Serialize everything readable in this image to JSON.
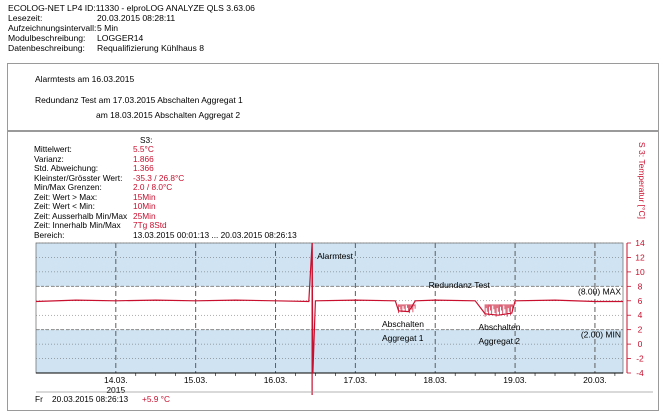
{
  "header": {
    "device_line": "ECOLOG-NET LP4  ID:11330    -  elproLOG ANALYZE QLS 3.63.06",
    "rows": [
      {
        "label": "Lesezeit:",
        "value": "20.03.2015  08:28:11"
      },
      {
        "label": "Aufzeichnungsintervall:",
        "value": "5 Min"
      },
      {
        "label": "Modulbeschreibung:",
        "value": "LOGGER14"
      },
      {
        "label": "Datenbeschreibung:",
        "value": "Requalifizierung Kühlhaus 8"
      }
    ]
  },
  "notes": {
    "line1": "Alarmtests am 16.03.2015",
    "line2": "Redundanz Test am 17.03.2015 Abschalten Aggregat 1",
    "line3": "am 18.03.2015 Abschalten Aggregat 2"
  },
  "stats": {
    "channel": "S3:",
    "rows": [
      {
        "label": "Mittelwert:",
        "value": "5.5°C"
      },
      {
        "label": "Varianz:",
        "value": "1.866"
      },
      {
        "label": "Std. Abweichung:",
        "value": "1.366"
      },
      {
        "label": "Kleinster/Grösster Wert:",
        "value": "-35.3 / 26.8°C"
      },
      {
        "label": "Min/Max Grenzen:",
        "value": "2.0 / 8.0°C"
      },
      {
        "label": "Zeit: Wert > Max:",
        "value": "15Min"
      },
      {
        "label": "Zeit: Wert < Min:",
        "value": "10Min"
      },
      {
        "label": "Zeit: Ausserhalb Min/Max",
        "value": "25Min"
      },
      {
        "label": "Zeit: Innerhalb Min/Max",
        "value": "7Tg 8Std"
      }
    ],
    "range_label": "Bereich:",
    "range_value": "13.03.2015  00:01:13  ...  20.03.2015  08:26:13"
  },
  "side_label": "S 3: Temperatur [°C]",
  "cursor": {
    "day": "Fr",
    "datetime": "20.03.2015  08:26:13",
    "value": "+5.9 °C"
  },
  "colors": {
    "series": "#c8102e",
    "band": "#cfe3f2",
    "grid": "#5e5e5e",
    "axis_text": "#c8102e"
  },
  "chart_data": {
    "type": "line",
    "series": [
      {
        "name": "S3",
        "unit": "°C"
      }
    ],
    "ylim": [
      -4,
      14
    ],
    "yticks": [
      -4,
      -2,
      0,
      2,
      4,
      6,
      8,
      10,
      12,
      14
    ],
    "xlim": [
      "13.03.2015 00:01",
      "20.03.2015 08:26"
    ],
    "xticks": [
      "14.03.",
      "15.03.",
      "16.03.",
      "17.03.",
      "18.03.",
      "19.03.",
      "20.03."
    ],
    "xtick_sub": "2015",
    "limits": {
      "max": 8.0,
      "min": 2.0,
      "max_label": "(8.00) MAX",
      "min_label": "(2.00) MIN"
    },
    "annotations": [
      {
        "text": "Alarmtest",
        "date": "16.03.2015 11:00"
      },
      {
        "text": "Redundanz Test",
        "date": "17.03.2015 22:00"
      },
      {
        "text": "Abschalten",
        "date": "17.03.2015 14:00"
      },
      {
        "text": "Aggregat 1",
        "date": "17.03.2015 14:00"
      },
      {
        "text": "Abschalten",
        "date": "18.03.2015 19:00"
      },
      {
        "text": "Aggregat 2",
        "date": "18.03.2015 19:00"
      }
    ],
    "points": [
      [
        "13.03.2015 00:01",
        5.9
      ],
      [
        "13.03.2015 12:00",
        6.1
      ],
      [
        "14.03.2015 00:00",
        6.0
      ],
      [
        "14.03.2015 12:00",
        6.1
      ],
      [
        "15.03.2015 00:00",
        6.0
      ],
      [
        "15.03.2015 12:00",
        6.1
      ],
      [
        "16.03.2015 00:00",
        6.0
      ],
      [
        "16.03.2015 10:00",
        5.9
      ],
      [
        "16.03.2015 11:00",
        14.0
      ],
      [
        "16.03.2015 11:15",
        -4.0
      ],
      [
        "16.03.2015 12:00",
        6.0
      ],
      [
        "17.03.2015 00:00",
        6.1
      ],
      [
        "17.03.2015 12:00",
        6.0
      ],
      [
        "17.03.2015 13:00",
        4.6
      ],
      [
        "17.03.2015 16:00",
        4.5
      ],
      [
        "17.03.2015 18:00",
        6.0
      ],
      [
        "18.03.2015 00:00",
        6.1
      ],
      [
        "18.03.2015 12:00",
        6.0
      ],
      [
        "18.03.2015 15:00",
        4.2
      ],
      [
        "18.03.2015 19:00",
        4.0
      ],
      [
        "18.03.2015 23:00",
        4.3
      ],
      [
        "19.03.2015 00:00",
        6.0
      ],
      [
        "19.03.2015 12:00",
        6.1
      ],
      [
        "20.03.2015 00:00",
        5.9
      ],
      [
        "20.03.2015 08:26",
        5.9
      ]
    ]
  }
}
